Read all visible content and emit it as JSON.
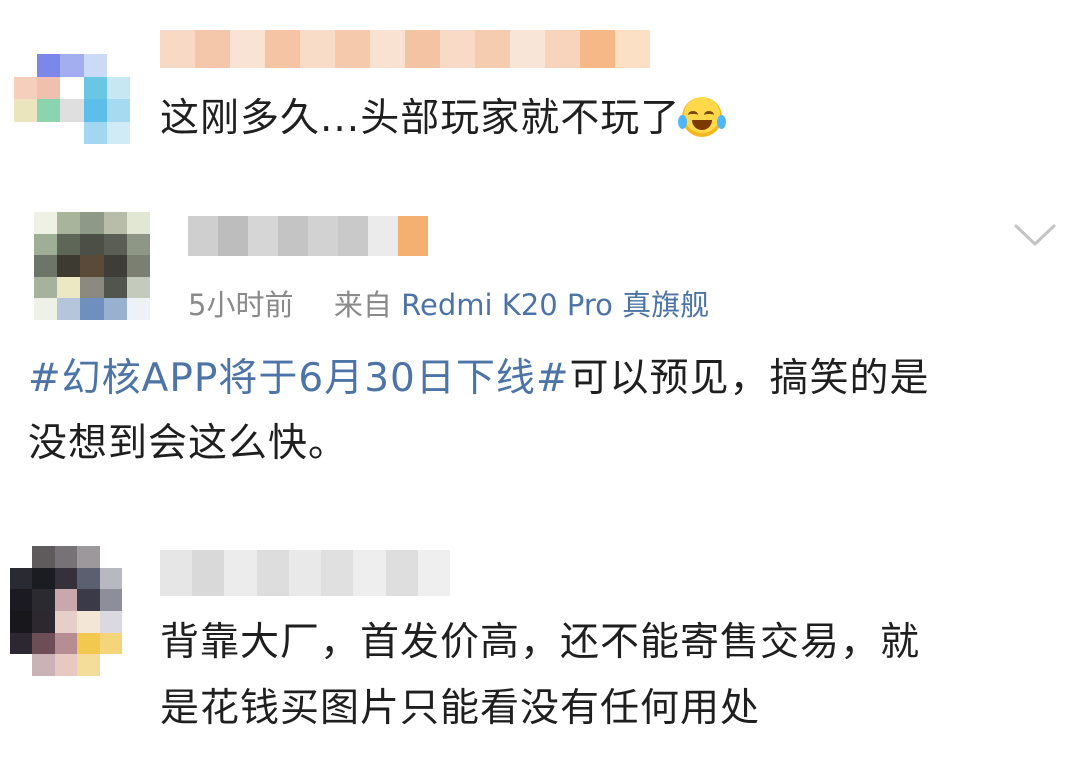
{
  "comments": [
    {
      "username_hidden": true,
      "text": "这刚多久...头部玩家就不玩了",
      "emoji": "laugh-cry-emoji"
    },
    {
      "username_hidden": true,
      "time": "5小时前",
      "source_prefix": "来自",
      "device": "Redmi K20 Pro 真旗舰",
      "topic": "#幻核APP将于6月30日下线#",
      "text_after_topic": "可以预见，搞笑的是",
      "text_line2": "没想到会这么快。"
    },
    {
      "username_hidden": true,
      "text_line1": "背靠大厂，首发价高，还不能寄售交易，就",
      "text_line2": "是花钱买图片只能看没有任何用处"
    }
  ],
  "icons": {
    "expand": "chevron-down-icon"
  },
  "colors": {
    "link": "#4d74a6",
    "meta": "#8a8a8a",
    "text": "#1f1f1f"
  }
}
